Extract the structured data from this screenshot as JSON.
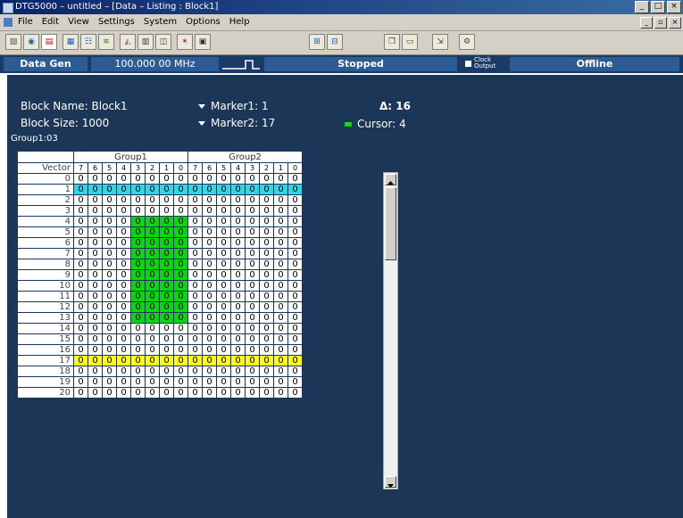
{
  "window": {
    "title": "DTG5000 – untitled – [Data – Listing : Block1]"
  },
  "menu": {
    "items": [
      "File",
      "Edit",
      "View",
      "Settings",
      "System",
      "Options",
      "Help"
    ]
  },
  "toolbar": {
    "icons": [
      "setup-icon",
      "timing-icon",
      "data-listing-icon",
      "pattern-icon",
      "group-icon",
      "waveform-icon",
      "marker-icon",
      "sequence-icon",
      "block-icon",
      "edit-pattern-icon",
      "properties-icon",
      "insert-icon",
      "overwrite-icon",
      "copy-icon",
      "paste-icon",
      "goto-icon",
      "settings-icon"
    ]
  },
  "status": {
    "mode": "Data Gen",
    "frequency": "100.000 00 MHz",
    "run_state": "Stopped",
    "clock_output_line1": "Clock",
    "clock_output_line2": "Output",
    "connection": "Offline"
  },
  "info": {
    "block_name": "Block Name: Block1",
    "block_size": "Block Size: 1000",
    "marker1": "Marker1: 1",
    "marker2": "Marker2: 17",
    "delta": "Δ: 16",
    "cursor": "Cursor: 4",
    "group_sel": "Group1:03"
  },
  "grid": {
    "vector_label": "Vector",
    "groups": [
      "Group1",
      "Group2"
    ],
    "bit_headers": [
      "7",
      "6",
      "5",
      "4",
      "3",
      "2",
      "1",
      "0"
    ],
    "rows": [
      {
        "vector": "0",
        "highlight": "none",
        "g1": [
          "0",
          "0",
          "0",
          "0",
          "0",
          "0",
          "0",
          "0"
        ],
        "g2": [
          "0",
          "0",
          "0",
          "0",
          "0",
          "0",
          "0",
          "0"
        ]
      },
      {
        "vector": "1",
        "highlight": "cyan",
        "g1": [
          "0",
          "0",
          "0",
          "0",
          "0",
          "0",
          "0",
          "0"
        ],
        "g2": [
          "0",
          "0",
          "0",
          "0",
          "0",
          "0",
          "0",
          "0"
        ]
      },
      {
        "vector": "2",
        "highlight": "none",
        "g1": [
          "0",
          "0",
          "0",
          "0",
          "0",
          "0",
          "0",
          "0"
        ],
        "g2": [
          "0",
          "0",
          "0",
          "0",
          "0",
          "0",
          "0",
          "0"
        ]
      },
      {
        "vector": "3",
        "highlight": "none",
        "g1": [
          "0",
          "0",
          "0",
          "0",
          "0",
          "0",
          "0",
          "0"
        ],
        "g2": [
          "0",
          "0",
          "0",
          "0",
          "0",
          "0",
          "0",
          "0"
        ]
      },
      {
        "vector": "4",
        "highlight": "green",
        "g1": [
          "0",
          "0",
          "0",
          "0",
          "0",
          "0",
          "0",
          "0"
        ],
        "g2": [
          "0",
          "0",
          "0",
          "0",
          "0",
          "0",
          "0",
          "0"
        ]
      },
      {
        "vector": "5",
        "highlight": "green",
        "g1": [
          "0",
          "0",
          "0",
          "0",
          "0",
          "0",
          "0",
          "0"
        ],
        "g2": [
          "0",
          "0",
          "0",
          "0",
          "0",
          "0",
          "0",
          "0"
        ]
      },
      {
        "vector": "6",
        "highlight": "green",
        "g1": [
          "0",
          "0",
          "0",
          "0",
          "0",
          "0",
          "0",
          "0"
        ],
        "g2": [
          "0",
          "0",
          "0",
          "0",
          "0",
          "0",
          "0",
          "0"
        ]
      },
      {
        "vector": "7",
        "highlight": "green",
        "g1": [
          "0",
          "0",
          "0",
          "0",
          "0",
          "0",
          "0",
          "0"
        ],
        "g2": [
          "0",
          "0",
          "0",
          "0",
          "0",
          "0",
          "0",
          "0"
        ]
      },
      {
        "vector": "8",
        "highlight": "green",
        "g1": [
          "0",
          "0",
          "0",
          "0",
          "0",
          "0",
          "0",
          "0"
        ],
        "g2": [
          "0",
          "0",
          "0",
          "0",
          "0",
          "0",
          "0",
          "0"
        ]
      },
      {
        "vector": "9",
        "highlight": "green",
        "g1": [
          "0",
          "0",
          "0",
          "0",
          "0",
          "0",
          "0",
          "0"
        ],
        "g2": [
          "0",
          "0",
          "0",
          "0",
          "0",
          "0",
          "0",
          "0"
        ]
      },
      {
        "vector": "10",
        "highlight": "green",
        "g1": [
          "0",
          "0",
          "0",
          "0",
          "0",
          "0",
          "0",
          "0"
        ],
        "g2": [
          "0",
          "0",
          "0",
          "0",
          "0",
          "0",
          "0",
          "0"
        ]
      },
      {
        "vector": "11",
        "highlight": "green",
        "g1": [
          "0",
          "0",
          "0",
          "0",
          "0",
          "0",
          "0",
          "0"
        ],
        "g2": [
          "0",
          "0",
          "0",
          "0",
          "0",
          "0",
          "0",
          "0"
        ]
      },
      {
        "vector": "12",
        "highlight": "green",
        "g1": [
          "0",
          "0",
          "0",
          "0",
          "0",
          "0",
          "0",
          "0"
        ],
        "g2": [
          "0",
          "0",
          "0",
          "0",
          "0",
          "0",
          "0",
          "0"
        ]
      },
      {
        "vector": "13",
        "highlight": "green",
        "g1": [
          "0",
          "0",
          "0",
          "0",
          "0",
          "0",
          "0",
          "0"
        ],
        "g2": [
          "0",
          "0",
          "0",
          "0",
          "0",
          "0",
          "0",
          "0"
        ]
      },
      {
        "vector": "14",
        "highlight": "none",
        "g1": [
          "0",
          "0",
          "0",
          "0",
          "0",
          "0",
          "0",
          "0"
        ],
        "g2": [
          "0",
          "0",
          "0",
          "0",
          "0",
          "0",
          "0",
          "0"
        ]
      },
      {
        "vector": "15",
        "highlight": "none",
        "g1": [
          "0",
          "0",
          "0",
          "0",
          "0",
          "0",
          "0",
          "0"
        ],
        "g2": [
          "0",
          "0",
          "0",
          "0",
          "0",
          "0",
          "0",
          "0"
        ]
      },
      {
        "vector": "16",
        "highlight": "none",
        "g1": [
          "0",
          "0",
          "0",
          "0",
          "0",
          "0",
          "0",
          "0"
        ],
        "g2": [
          "0",
          "0",
          "0",
          "0",
          "0",
          "0",
          "0",
          "0"
        ]
      },
      {
        "vector": "17",
        "highlight": "yellow",
        "g1": [
          "0",
          "0",
          "0",
          "0",
          "0",
          "0",
          "0",
          "0"
        ],
        "g2": [
          "0",
          "0",
          "0",
          "0",
          "0",
          "0",
          "0",
          "0"
        ]
      },
      {
        "vector": "18",
        "highlight": "none",
        "g1": [
          "0",
          "0",
          "0",
          "0",
          "0",
          "0",
          "0",
          "0"
        ],
        "g2": [
          "0",
          "0",
          "0",
          "0",
          "0",
          "0",
          "0",
          "0"
        ]
      },
      {
        "vector": "19",
        "highlight": "none",
        "g1": [
          "0",
          "0",
          "0",
          "0",
          "0",
          "0",
          "0",
          "0"
        ],
        "g2": [
          "0",
          "0",
          "0",
          "0",
          "0",
          "0",
          "0",
          "0"
        ]
      },
      {
        "vector": "20",
        "highlight": "none",
        "g1": [
          "0",
          "0",
          "0",
          "0",
          "0",
          "0",
          "0",
          "0"
        ],
        "g2": [
          "0",
          "0",
          "0",
          "0",
          "0",
          "0",
          "0",
          "0"
        ]
      }
    ]
  },
  "colors": {
    "panel_bg": "#1c3658",
    "status_box": "#2d5b94",
    "marker1_row": "#22dcea",
    "marker2_row": "#ffff00",
    "cursor_block": "#00dd00"
  }
}
